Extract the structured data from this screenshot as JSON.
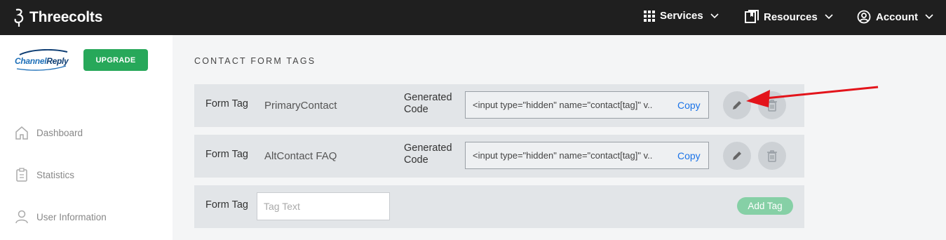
{
  "colors": {
    "topbar": "#1f1f1f",
    "upgrade": "#27a85a",
    "add_tag": "#86d0a6",
    "copy_link": "#1a73e8",
    "arrow": "#e3141b"
  },
  "topbar": {
    "brand": "Threecolts",
    "nav": {
      "services": "Services",
      "resources": "Resources",
      "account": "Account"
    }
  },
  "sidebar": {
    "logo_text_a": "Channel",
    "logo_text_b": "Reply",
    "upgrade_label": "UPGRADE",
    "items": [
      {
        "label": "Dashboard",
        "icon": "home-icon"
      },
      {
        "label": "Statistics",
        "icon": "clipboard-icon"
      },
      {
        "label": "User Information",
        "icon": "user-icon"
      }
    ]
  },
  "main": {
    "title": "CONTACT FORM TAGS",
    "rows": [
      {
        "form_tag_label": "Form Tag",
        "tag": "PrimaryContact",
        "generated_label": "Generated Code",
        "code": "<input type=\"hidden\" name=\"contact[tag]\" v..",
        "copy": "Copy"
      },
      {
        "form_tag_label": "Form Tag",
        "tag": "AltContact FAQ",
        "generated_label": "Generated Code",
        "code": "<input type=\"hidden\" name=\"contact[tag]\" v..",
        "copy": "Copy"
      }
    ],
    "new_row": {
      "form_tag_label": "Form Tag",
      "placeholder": "Tag Text",
      "value": "",
      "add_label": "Add Tag"
    }
  }
}
